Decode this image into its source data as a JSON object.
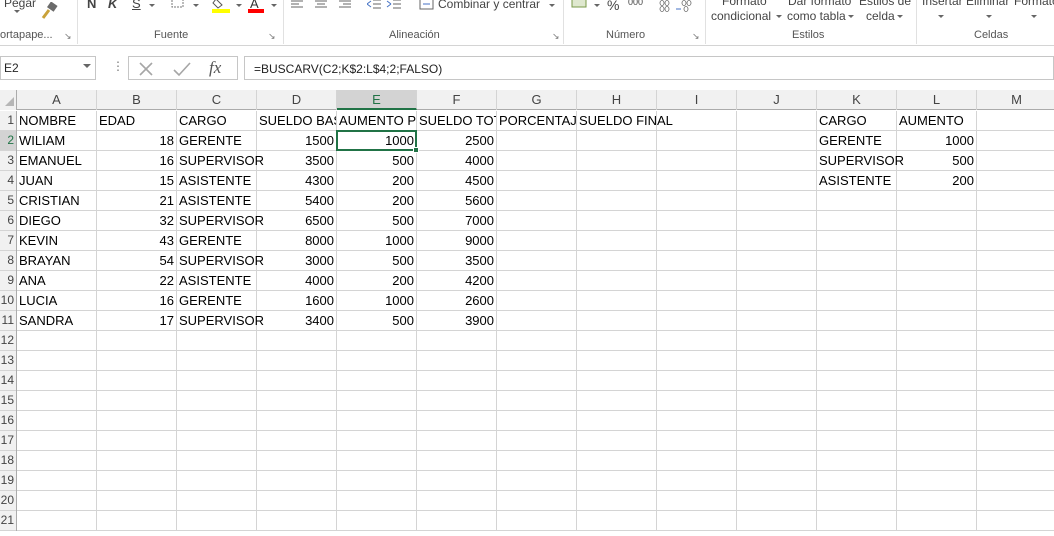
{
  "ribbon": {
    "paste_label": "Pegar",
    "bold": "N",
    "italic": "K",
    "underline": "S",
    "merge_label": "Combinar y centrar",
    "percent": "%",
    "thousands": "000",
    "conditional_format_line1": "Formato",
    "conditional_format_line2": "condicional",
    "table_format_line1": "Dar formato",
    "table_format_line2": "como tabla",
    "cell_styles_line1": "Estilos de",
    "cell_styles_line2": "celda",
    "insert_label": "Insertar",
    "delete_label": "Eliminar",
    "format_label": "Formato",
    "groups": {
      "clipboard": "ortapape...",
      "font": "Fuente",
      "alignment": "Alineación",
      "number": "Número",
      "styles": "Estilos",
      "cells": "Celdas"
    },
    "colors": {
      "highlight": "#ffff00",
      "font_color": "#ff0000"
    }
  },
  "formula_bar": {
    "name_box": "E2",
    "formula": "=BUSCARV(C2;K$2:L$4;2;FALSO)",
    "cancel_icon": "x-icon",
    "enter_icon": "check-icon",
    "function_icon": "fx"
  },
  "columns": [
    "A",
    "B",
    "C",
    "D",
    "E",
    "F",
    "G",
    "H",
    "I",
    "J",
    "K",
    "L",
    "M"
  ],
  "row_numbers": [
    "1",
    "2",
    "3",
    "4",
    "5",
    "6",
    "7",
    "8",
    "9",
    "10",
    "11",
    "12",
    "13",
    "14",
    "15",
    "16",
    "17",
    "18",
    "19",
    "20",
    "21"
  ],
  "active_cell": "E2",
  "sheet": {
    "headers": [
      "NOMBRE",
      "EDAD",
      "CARGO",
      "SUELDO BASE",
      "AUMENTO POR CARGO",
      "SUELDO TOTAL",
      "PORCENTAJE",
      "SUELDO FINAL"
    ],
    "rows": [
      [
        "WILIAM",
        "18",
        "GERENTE",
        "1500",
        "1000",
        "2500"
      ],
      [
        "EMANUEL",
        "16",
        "SUPERVISOR",
        "3500",
        "500",
        "4000"
      ],
      [
        "JUAN",
        "15",
        "ASISTENTE",
        "4300",
        "200",
        "4500"
      ],
      [
        "CRISTIAN",
        "21",
        "ASISTENTE",
        "5400",
        "200",
        "5600"
      ],
      [
        "DIEGO",
        "32",
        "SUPERVISOR",
        "6500",
        "500",
        "7000"
      ],
      [
        "KEVIN",
        "43",
        "GERENTE",
        "8000",
        "1000",
        "9000"
      ],
      [
        "BRAYAN",
        "54",
        "SUPERVISOR",
        "3000",
        "500",
        "3500"
      ],
      [
        "ANA",
        "22",
        "ASISTENTE",
        "4000",
        "200",
        "4200"
      ],
      [
        "LUCIA",
        "16",
        "GERENTE",
        "1600",
        "1000",
        "2600"
      ],
      [
        "SANDRA",
        "17",
        "SUPERVISOR",
        "3400",
        "500",
        "3900"
      ]
    ],
    "lookup_headers": [
      "CARGO",
      "AUMENTO"
    ],
    "lookup_rows": [
      [
        "GERENTE",
        "1000"
      ],
      [
        "SUPERVISOR",
        "500"
      ],
      [
        "ASISTENTE",
        "200"
      ]
    ]
  },
  "accent_color": "#217346"
}
